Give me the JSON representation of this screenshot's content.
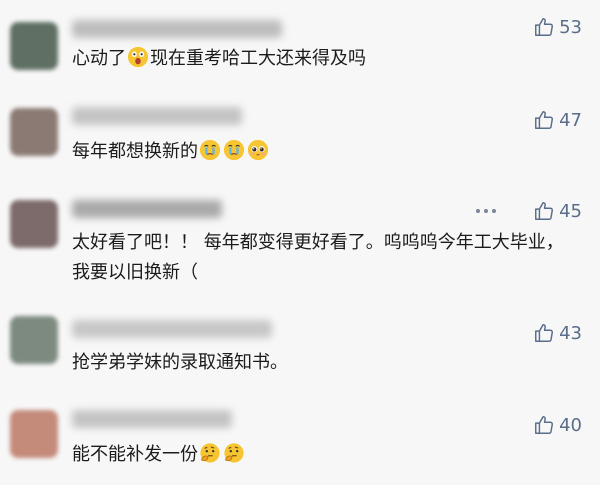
{
  "comments": [
    {
      "text": "心动了",
      "text_after_emoji": "现在重考哈工大还来得及吗",
      "likes": "53",
      "emojis": [
        "shocked-face-emoji"
      ],
      "avatar_color": "#5f6f63",
      "name_color": "#8e8e8e"
    },
    {
      "text": "每年都想换新的",
      "likes": "47",
      "emojis": [
        "crying-face-emoji",
        "crying-face-emoji",
        "pleading-face-emoji"
      ],
      "avatar_color": "#8a7a73",
      "name_color": "#9a9a9a"
    },
    {
      "text": "太好看了吧！！ 每年都变得更好看了。呜呜呜今年工大毕业，我要以旧换新（",
      "likes": "45",
      "avatar_color": "#7d6a6a",
      "name_color": "#6a6a6a"
    },
    {
      "text": "抢学弟学妹的录取通知书。",
      "likes": "43",
      "avatar_color": "#7d8a80",
      "name_color": "#a0a0a0"
    },
    {
      "text": "能不能补发一份",
      "likes": "40",
      "emojis": [
        "thinking-face-emoji",
        "thinking-face-emoji"
      ],
      "avatar_color": "#c48a7a",
      "name_color": "#9a9a9a"
    }
  ],
  "icons": {
    "like": "thumbs-up-icon",
    "more": "more-dots-icon"
  }
}
